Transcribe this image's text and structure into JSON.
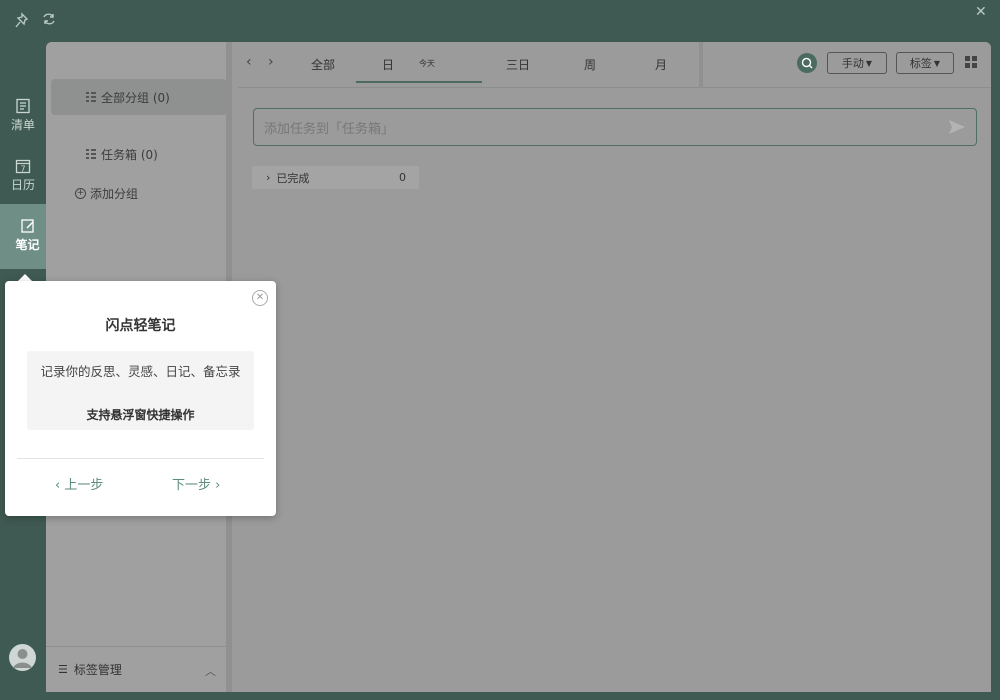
{
  "rail": {
    "items": [
      {
        "label": "清单",
        "icon": "list-icon"
      },
      {
        "label": "日历",
        "icon": "calendar-icon",
        "day": "7"
      },
      {
        "label": "笔记",
        "icon": "note-icon"
      }
    ]
  },
  "sidebar": {
    "all_groups": "全部分组 (0)",
    "inbox": "任务箱 (0)",
    "add_group": "添加分组",
    "tag_manage": "标签管理"
  },
  "tabs": {
    "items": [
      "全部",
      "日",
      "三日",
      "周",
      "月"
    ],
    "today_label": "今天"
  },
  "toolbar": {
    "sort_label": "手动",
    "tag_label": "标签"
  },
  "task_input": {
    "placeholder": "添加任务到「任务箱」"
  },
  "completed": {
    "label": "已完成",
    "count": "0"
  },
  "popup": {
    "title": "闪点轻笔记",
    "desc_line1": "记录你的反思、灵感、日记、备忘录",
    "desc_line2": "支持悬浮窗快捷操作",
    "prev": "上一步",
    "next": "下一步"
  },
  "colors": {
    "accent": "#4b6b61",
    "rail_bg": "#3f5a52",
    "overlay_panel": "#9b9b9b",
    "link": "#5d8b7d"
  }
}
